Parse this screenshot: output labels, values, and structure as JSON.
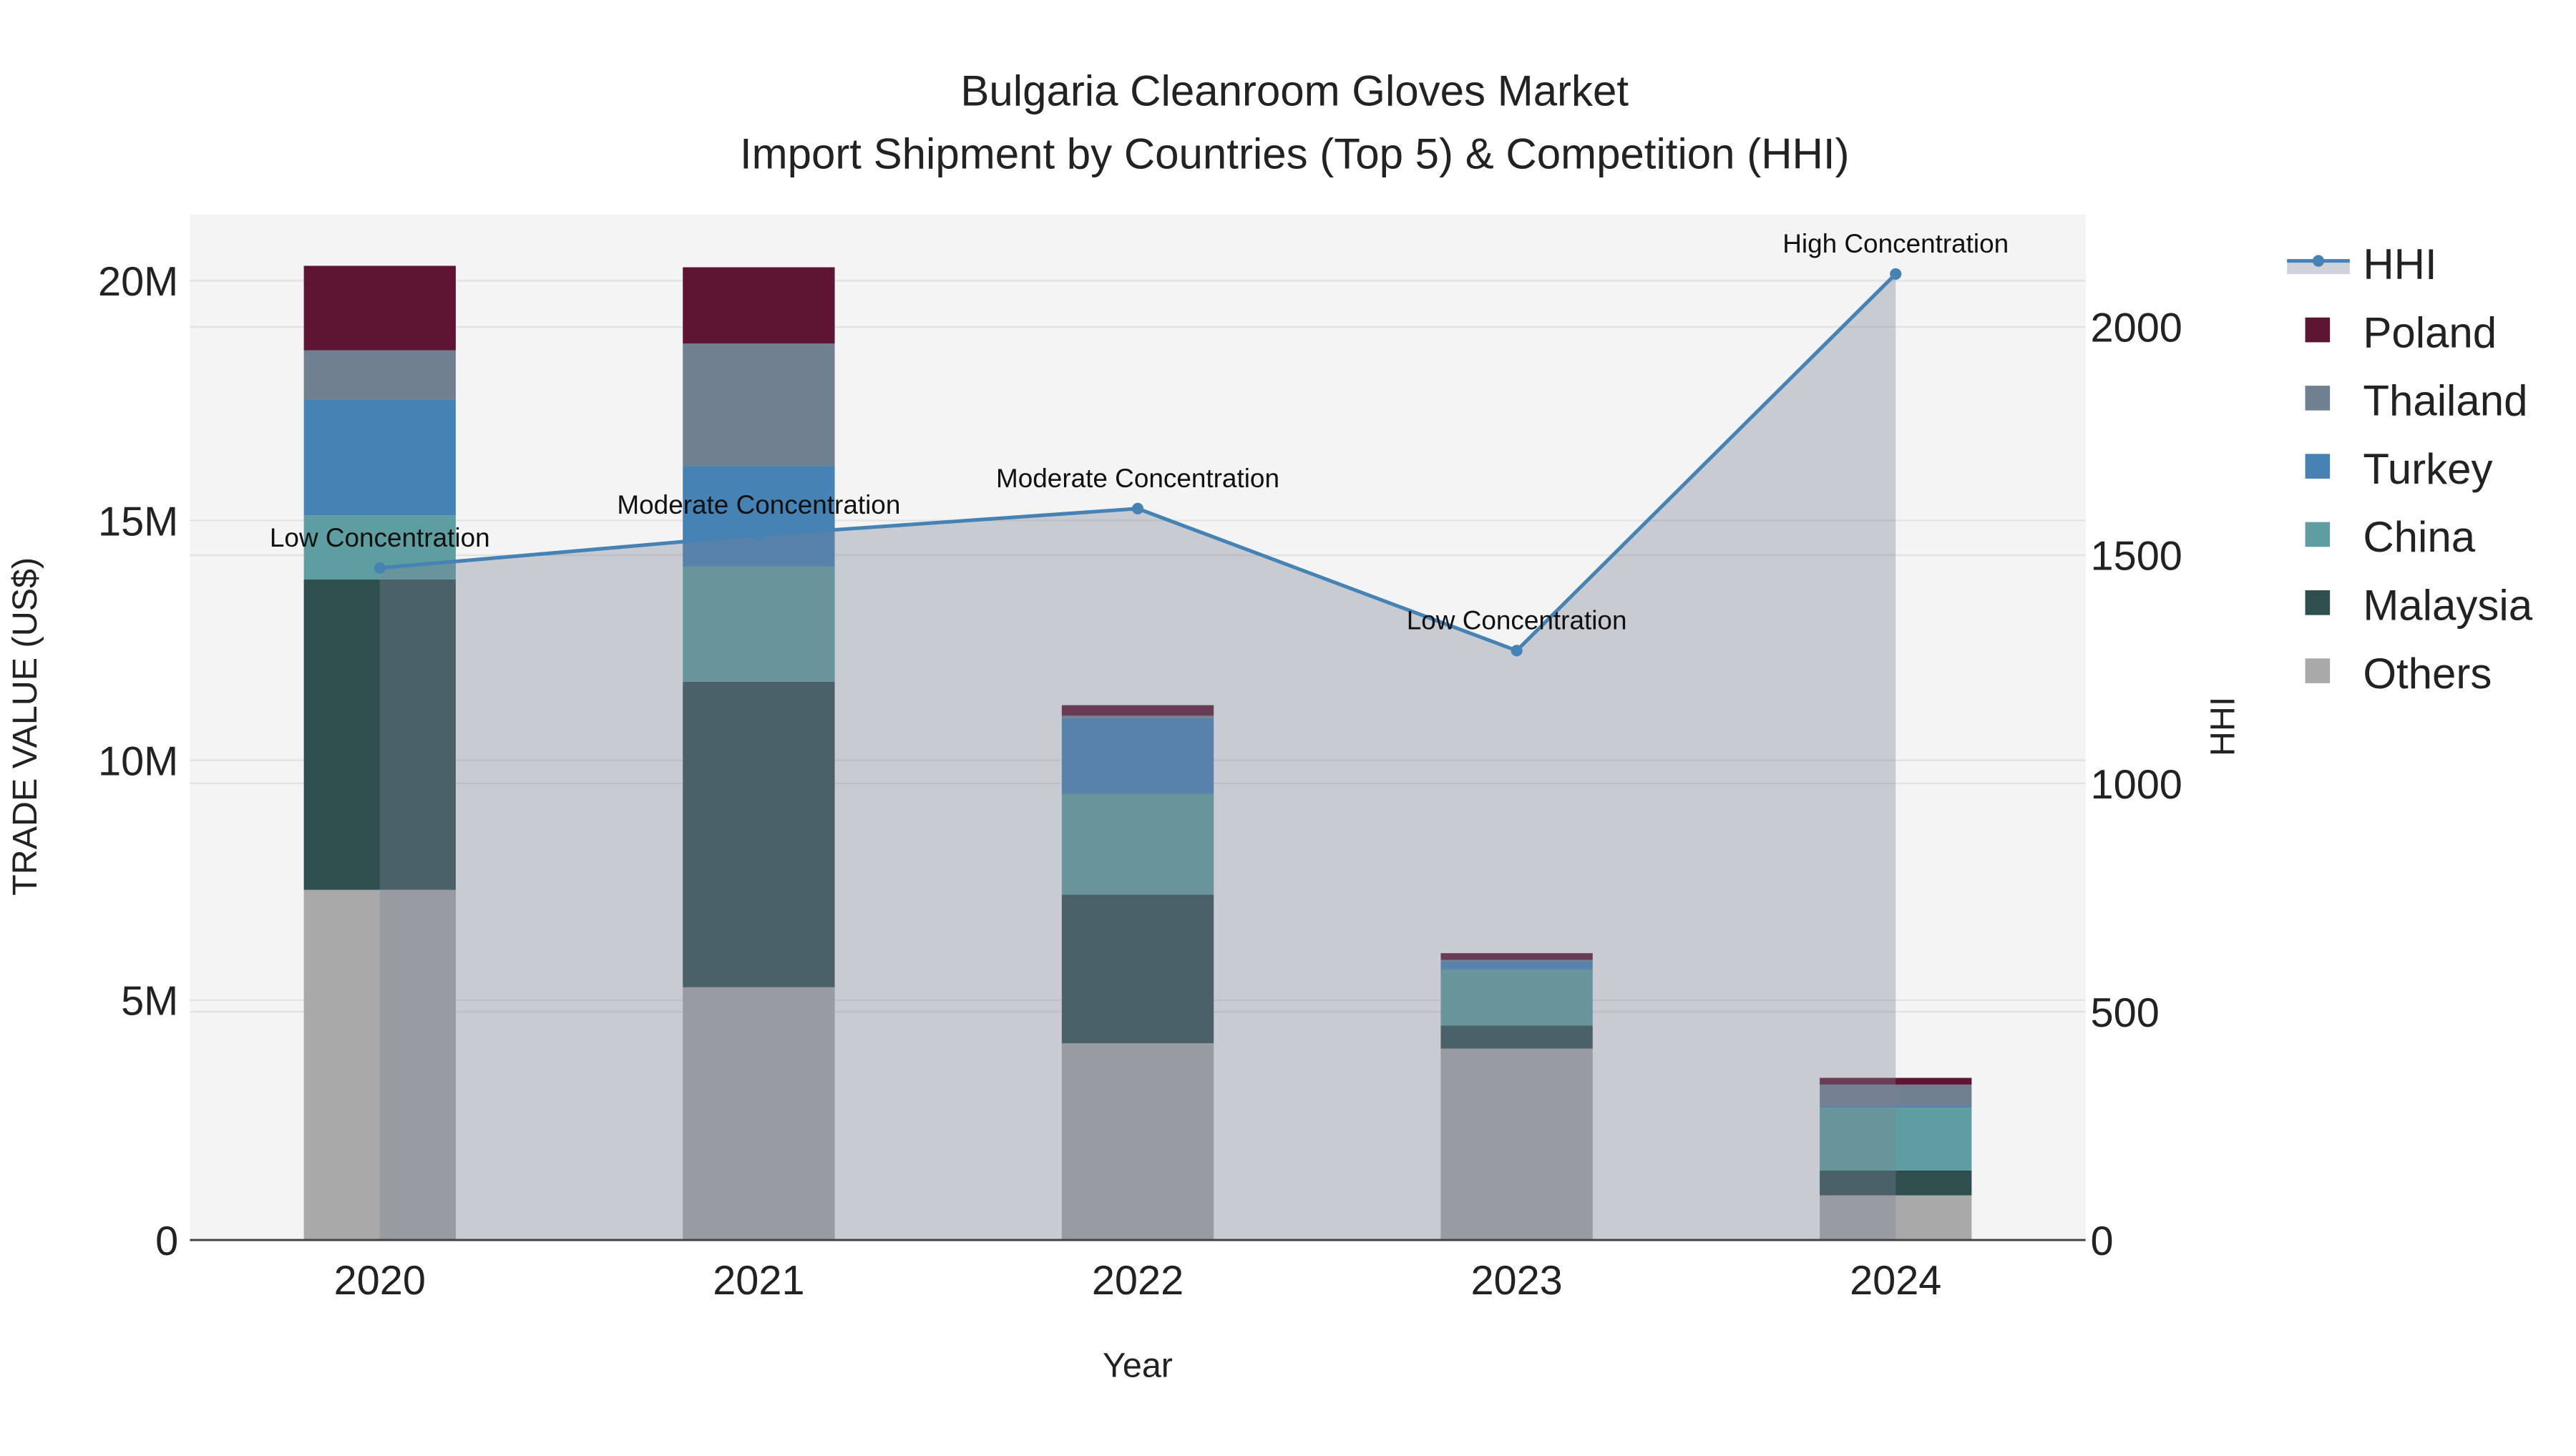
{
  "chart_data": {
    "type": "bar",
    "title": "Bulgaria Cleanroom Gloves Market",
    "subtitle": "Import Shipment by Countries (Top 5) & Competition (HHI)",
    "xlabel": "Year",
    "ylabel": "TRADE VALUE (US$)",
    "y2label": "HHI",
    "categories": [
      "2020",
      "2021",
      "2022",
      "2023",
      "2024"
    ],
    "ylim": [
      0,
      21.4
    ],
    "y_unit": "million US$",
    "y_ticks": [
      {
        "v": 0,
        "label": "0"
      },
      {
        "v": 5,
        "label": "5M"
      },
      {
        "v": 10,
        "label": "10M"
      },
      {
        "v": 15,
        "label": "15M"
      },
      {
        "v": 20,
        "label": "20M"
      }
    ],
    "y2lim": [
      0,
      2245
    ],
    "y2_ticks": [
      {
        "v": 0,
        "label": "0"
      },
      {
        "v": 500,
        "label": "500"
      },
      {
        "v": 1000,
        "label": "1000"
      },
      {
        "v": 1500,
        "label": "1500"
      },
      {
        "v": 2000,
        "label": "2000"
      }
    ],
    "series": [
      {
        "name": "Others",
        "color": "#a9a9a9",
        "values": [
          7.3,
          5.27,
          4.1,
          3.99,
          0.93
        ]
      },
      {
        "name": "Malaysia",
        "color": "#2f4f4f",
        "values": [
          6.47,
          6.37,
          3.1,
          0.48,
          0.52
        ]
      },
      {
        "name": "China",
        "color": "#5f9ea0",
        "values": [
          1.34,
          2.4,
          2.1,
          1.17,
          1.31
        ]
      },
      {
        "name": "Turkey",
        "color": "#4682b4",
        "values": [
          2.41,
          2.1,
          1.58,
          0.17,
          0.03
        ]
      },
      {
        "name": "Thailand",
        "color": "#708090",
        "values": [
          1.03,
          2.55,
          0.05,
          0.03,
          0.45
        ]
      },
      {
        "name": "Poland",
        "color": "#5e1534",
        "values": [
          1.76,
          1.59,
          0.22,
          0.14,
          0.14
        ]
      }
    ],
    "hhi": {
      "name": "HHI",
      "color": "#4682b4",
      "values": [
        1472,
        1544,
        1602,
        1291,
        2116
      ],
      "annotations": [
        "Low Concentration",
        "Moderate Concentration",
        "Moderate Concentration",
        "Low Concentration",
        "High Concentration"
      ]
    },
    "legend": [
      "HHI",
      "Poland",
      "Thailand",
      "Turkey",
      "China",
      "Malaysia",
      "Others"
    ],
    "legend_placement": "right",
    "grid": true
  }
}
